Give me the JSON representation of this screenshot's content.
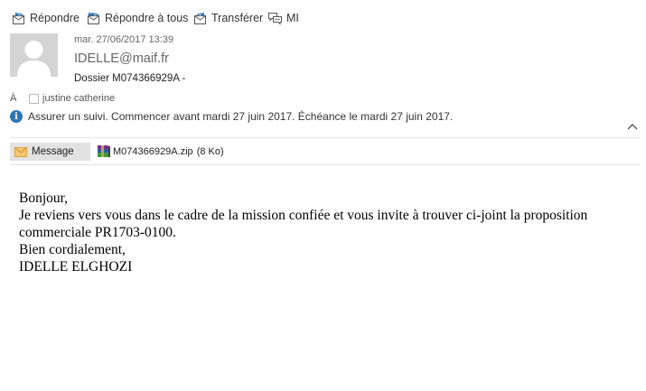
{
  "toolbar": {
    "reply": "Répondre",
    "reply_all": "Répondre à tous",
    "forward": "Transférer",
    "im": "MI"
  },
  "header": {
    "date": "mar. 27/06/2017 13:39",
    "sender": "IDELLE@maif.fr",
    "subject": "Dossier M074366929A -"
  },
  "recipients": {
    "label": "À",
    "to": "justine catherine"
  },
  "followup": {
    "text": "Assurer un suivi.  Commencer avant mardi 27 juin 2017.  Échéance le mardi 27 juin 2017."
  },
  "attachments": {
    "message_tab": "Message",
    "file_name": "M074366929A.zip",
    "file_size": "(8 Ko)"
  },
  "body": {
    "lines": [
      "Bonjour,",
      "Je reviens vers vous dans le cadre de la mission confiée et vous invite à trouver ci-joint la proposition",
      "commerciale PR1703-0100.",
      "Bien cordialement,",
      "IDELLE ELGHOZI"
    ]
  }
}
